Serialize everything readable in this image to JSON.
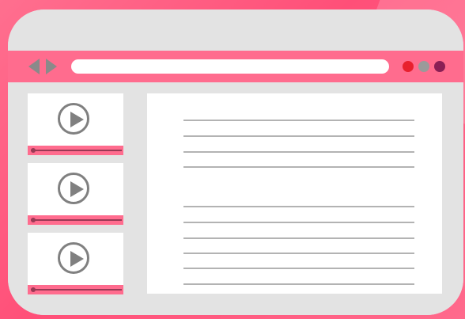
{
  "colors": {
    "background": "#ff5a80",
    "window": "#e3e3e3",
    "toolbar": "#ff6c8e",
    "panel": "#ffffff",
    "icon": "#808080",
    "text_line": "#b3b3b3"
  },
  "toolbar": {
    "back_icon": "arrow-left-icon",
    "forward_icon": "arrow-right-icon",
    "address_value": "",
    "dots": [
      {
        "name": "red",
        "color": "#e8202e"
      },
      {
        "name": "gray",
        "color": "#9a9a9a"
      },
      {
        "name": "purple",
        "color": "#8a1f55"
      }
    ]
  },
  "video_list": [
    {
      "icon": "play-icon",
      "progress": 0.0
    },
    {
      "icon": "play-icon",
      "progress": 0.0
    },
    {
      "icon": "play-icon",
      "progress": 0.0
    }
  ],
  "document": {
    "paragraphs": [
      {
        "line_count": 4
      },
      {
        "line_count": 6
      }
    ]
  }
}
